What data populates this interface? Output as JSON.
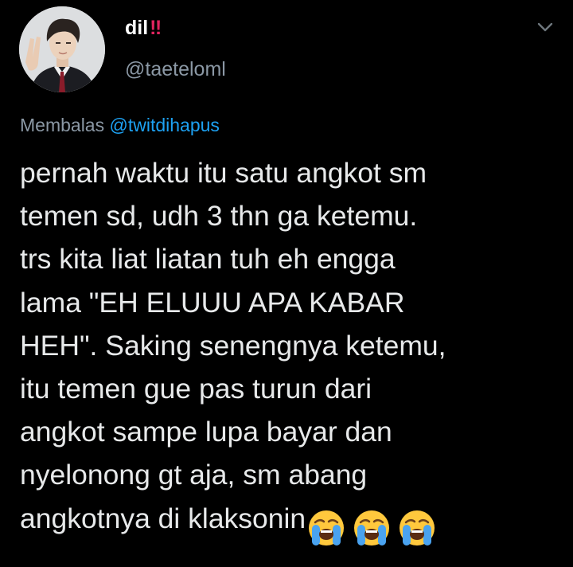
{
  "tweet": {
    "display_name": "dil",
    "name_badge": "‼",
    "handle": "@taeteloml",
    "reply_label": "Membalas",
    "reply_mention": "@twitdihapus",
    "body_lines": [
      "pernah waktu itu satu angkot sm",
      "temen sd, udh 3 thn ga ketemu.",
      "trs kita liat liatan tuh eh engga",
      "lama \"EH ELUUU APA KABAR",
      "HEH\". Saking senengnya ketemu,",
      "itu temen gue pas turun dari",
      "angkot sampe lupa bayar dan",
      "nyelonong gt aja, sm abang",
      "angkotnya di klaksonin"
    ],
    "trailing_emojis": [
      "loudly-crying-face",
      "loudly-crying-face",
      "loudly-crying-face"
    ]
  },
  "icons": {
    "menu": "chevron-down-icon",
    "avatar": "profile-photo"
  },
  "colors": {
    "background": "#000000",
    "name": "#ffffff",
    "handle": "#8b98a5",
    "mention": "#1da1f2",
    "badge": "#e0245e",
    "text": "#e7e9ea"
  }
}
